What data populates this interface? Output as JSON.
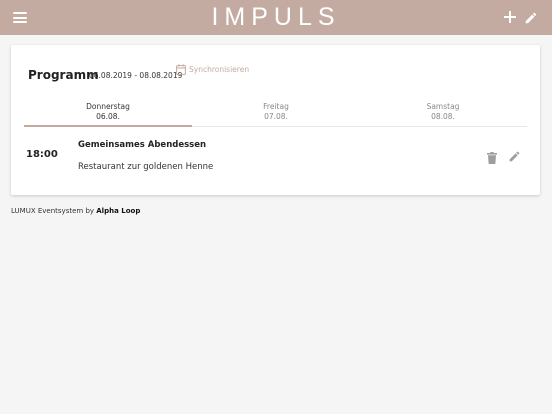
{
  "appbar": {
    "brand": "IMPULS",
    "icons": {
      "menu": "menu-icon",
      "add": "plus-icon",
      "edit": "pencil-icon"
    },
    "color": "#c4aba1"
  },
  "program": {
    "title": "Programm",
    "date_range": "06.08.2019 - 08.08.2019",
    "sync_label": "Synchronisieren",
    "sync_icon": "calendar-icon"
  },
  "tabs": [
    {
      "day": "Donnerstag",
      "date": "06.08.",
      "active": true
    },
    {
      "day": "Freitag",
      "date": "07.08.",
      "active": false
    },
    {
      "day": "Samstag",
      "date": "08.08.",
      "active": false
    }
  ],
  "event": {
    "time": "18:00",
    "title": "Gemeinsames Abendessen",
    "location": "Restaurant zur goldenen Henne",
    "icons": {
      "delete": "trash-icon",
      "edit": "pencil-icon"
    }
  },
  "footer": {
    "prefix": "LUMUX Eventsystem by",
    "company": "Alpha Loop"
  }
}
